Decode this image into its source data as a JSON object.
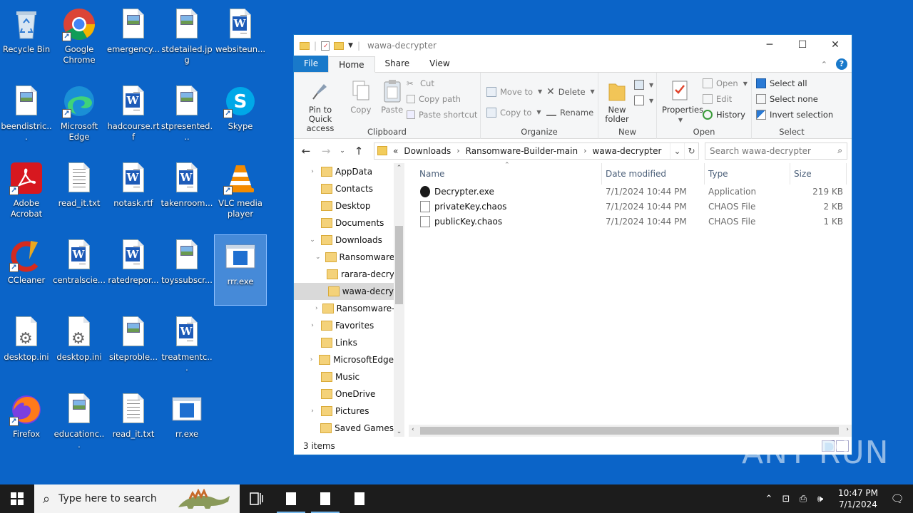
{
  "desktop": {
    "icons": [
      {
        "label": "Recycle Bin"
      },
      {
        "label": "Google Chrome"
      },
      {
        "label": "emergency..."
      },
      {
        "label": "stdetailed.jpg"
      },
      {
        "label": "websiteun..."
      },
      {
        "label": "beendistric..."
      },
      {
        "label": "Microsoft Edge"
      },
      {
        "label": "hadcourse.rtf"
      },
      {
        "label": "stpresented..."
      },
      {
        "label": "Skype"
      },
      {
        "label": "Adobe Acrobat"
      },
      {
        "label": "read_it.txt"
      },
      {
        "label": "notask.rtf"
      },
      {
        "label": "takenroom..."
      },
      {
        "label": "VLC media player"
      },
      {
        "label": "CCleaner"
      },
      {
        "label": "centralscie..."
      },
      {
        "label": "ratedrepor..."
      },
      {
        "label": "toyssubscr..."
      },
      {
        "label": "rrr.exe"
      },
      {
        "label": "desktop.ini"
      },
      {
        "label": "desktop.ini"
      },
      {
        "label": "siteproble..."
      },
      {
        "label": "treatmentc..."
      },
      {
        "label": "Firefox"
      },
      {
        "label": "educationc..."
      },
      {
        "label": "read_it.txt"
      },
      {
        "label": "rr.exe"
      }
    ]
  },
  "explorer": {
    "title": "wawa-decrypter",
    "tabs": {
      "file": "File",
      "home": "Home",
      "share": "Share",
      "view": "View"
    },
    "ribbon": {
      "clipboard": {
        "name": "Clipboard",
        "pin": "Pin to Quick access",
        "copy": "Copy",
        "paste": "Paste",
        "cut": "Cut",
        "copy_path": "Copy path",
        "paste_shortcut": "Paste shortcut"
      },
      "organize": {
        "name": "Organize",
        "move_to": "Move to",
        "copy_to": "Copy to",
        "delete": "Delete",
        "rename": "Rename"
      },
      "new": {
        "name": "New",
        "new_folder": "New folder"
      },
      "open": {
        "name": "Open",
        "properties": "Properties",
        "open": "Open",
        "edit": "Edit",
        "history": "History"
      },
      "select": {
        "name": "Select",
        "select_all": "Select all",
        "select_none": "Select none",
        "invert": "Invert selection"
      }
    },
    "address": {
      "overflow": "«",
      "crumbs": [
        "Downloads",
        "Ransomware-Builder-main",
        "wawa-decrypter"
      ]
    },
    "search_placeholder": "Search wawa-decrypter",
    "nav": [
      {
        "label": "AppData",
        "indent": 0,
        "exp": "›"
      },
      {
        "label": "Contacts",
        "indent": 0,
        "exp": ""
      },
      {
        "label": "Desktop",
        "indent": 0,
        "exp": ""
      },
      {
        "label": "Documents",
        "indent": 0,
        "exp": ""
      },
      {
        "label": "Downloads",
        "indent": 0,
        "exp": "⌄"
      },
      {
        "label": "Ransomware-",
        "indent": 1,
        "exp": "⌄"
      },
      {
        "label": "rarara-decry",
        "indent": 2,
        "exp": ""
      },
      {
        "label": "wawa-decry",
        "indent": 2,
        "exp": ""
      },
      {
        "label": "Ransomware-",
        "indent": 1,
        "exp": "›"
      },
      {
        "label": "Favorites",
        "indent": 0,
        "exp": "›"
      },
      {
        "label": "Links",
        "indent": 0,
        "exp": ""
      },
      {
        "label": "MicrosoftEdge",
        "indent": 0,
        "exp": "›"
      },
      {
        "label": "Music",
        "indent": 0,
        "exp": ""
      },
      {
        "label": "OneDrive",
        "indent": 0,
        "exp": ""
      },
      {
        "label": "Pictures",
        "indent": 0,
        "exp": "›"
      },
      {
        "label": "Saved Games",
        "indent": 0,
        "exp": ""
      }
    ],
    "columns": {
      "name": "Name",
      "date": "Date modified",
      "type": "Type",
      "size": "Size"
    },
    "files": [
      {
        "name": "Decrypter.exe",
        "date": "7/1/2024 10:44 PM",
        "type": "Application",
        "size": "219 KB"
      },
      {
        "name": "privateKey.chaos",
        "date": "7/1/2024 10:44 PM",
        "type": "CHAOS File",
        "size": "2 KB"
      },
      {
        "name": "publicKey.chaos",
        "date": "7/1/2024 10:44 PM",
        "type": "CHAOS File",
        "size": "1 KB"
      }
    ],
    "status": "3 items"
  },
  "taskbar": {
    "search_placeholder": "Type here to search",
    "time": "10:47 PM",
    "date": "7/1/2024"
  },
  "watermark": "ANY RUN",
  "colors": {
    "desktop": "#0b64c8",
    "accent": "#1979ca",
    "taskbar": "#1c1c1c"
  }
}
